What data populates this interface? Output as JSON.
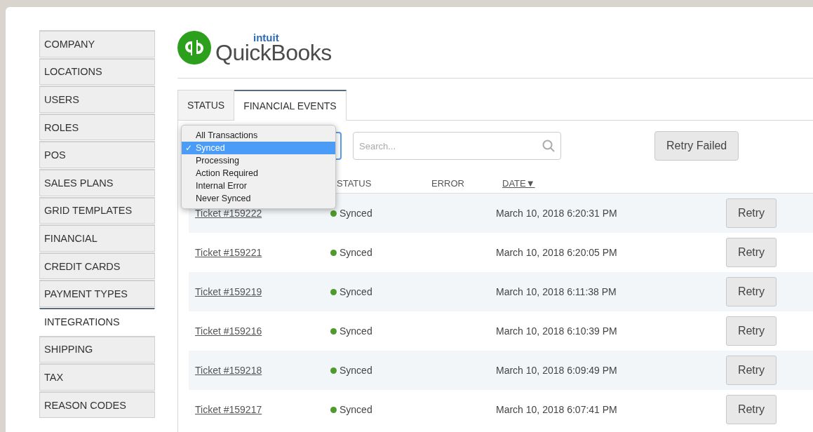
{
  "sidebar": {
    "items": [
      {
        "label": "COMPANY",
        "selected": false
      },
      {
        "label": "LOCATIONS",
        "selected": false
      },
      {
        "label": "USERS",
        "selected": false
      },
      {
        "label": "ROLES",
        "selected": false
      },
      {
        "label": "POS",
        "selected": false
      },
      {
        "label": "SALES PLANS",
        "selected": false
      },
      {
        "label": "GRID TEMPLATES",
        "selected": false
      },
      {
        "label": "FINANCIAL",
        "selected": false
      },
      {
        "label": "CREDIT CARDS",
        "selected": false
      },
      {
        "label": "PAYMENT TYPES",
        "selected": false
      },
      {
        "label": "INTEGRATIONS",
        "selected": true
      },
      {
        "label": "SHIPPING",
        "selected": false
      },
      {
        "label": "TAX",
        "selected": false
      },
      {
        "label": "REASON CODES",
        "selected": false
      }
    ]
  },
  "logo": {
    "brand": "intuit",
    "product": "QuickBooks"
  },
  "tabs": [
    {
      "label": "STATUS",
      "selected": false
    },
    {
      "label": "FINANCIAL EVENTS",
      "selected": true
    }
  ],
  "filter_menu": {
    "options": [
      {
        "label": "All Transactions",
        "selected": false
      },
      {
        "label": "Synced",
        "selected": true
      },
      {
        "label": "Processing",
        "selected": false
      },
      {
        "label": "Action Required",
        "selected": false
      },
      {
        "label": "Internal Error",
        "selected": false
      },
      {
        "label": "Never Synced",
        "selected": false
      }
    ],
    "check": "✓"
  },
  "search": {
    "placeholder": "Search..."
  },
  "retry_failed": "Retry Failed",
  "table": {
    "columns": [
      "STATUS",
      "ERROR",
      "DATE▼"
    ],
    "rows": [
      {
        "ticket": "Ticket #159222",
        "status": "Synced",
        "color": "#4e9a2e",
        "date": "March 10, 2018 6:20:31 PM",
        "action": "Retry"
      },
      {
        "ticket": "Ticket #159221",
        "status": "Synced",
        "color": "#4e9a2e",
        "date": "March 10, 2018 6:20:05 PM",
        "action": "Retry"
      },
      {
        "ticket": "Ticket #159219",
        "status": "Synced",
        "color": "#4e9a2e",
        "date": "March 10, 2018 6:11:38 PM",
        "action": "Retry"
      },
      {
        "ticket": "Ticket #159216",
        "status": "Synced",
        "color": "#4e9a2e",
        "date": "March 10, 2018 6:10:39 PM",
        "action": "Retry"
      },
      {
        "ticket": "Ticket #159218",
        "status": "Synced",
        "color": "#4e9a2e",
        "date": "March 10, 2018 6:09:49 PM",
        "action": "Retry"
      },
      {
        "ticket": "Ticket #159217",
        "status": "Synced",
        "color": "#4e9a2e",
        "date": "March 10, 2018 6:07:41 PM",
        "action": "Retry"
      }
    ]
  }
}
